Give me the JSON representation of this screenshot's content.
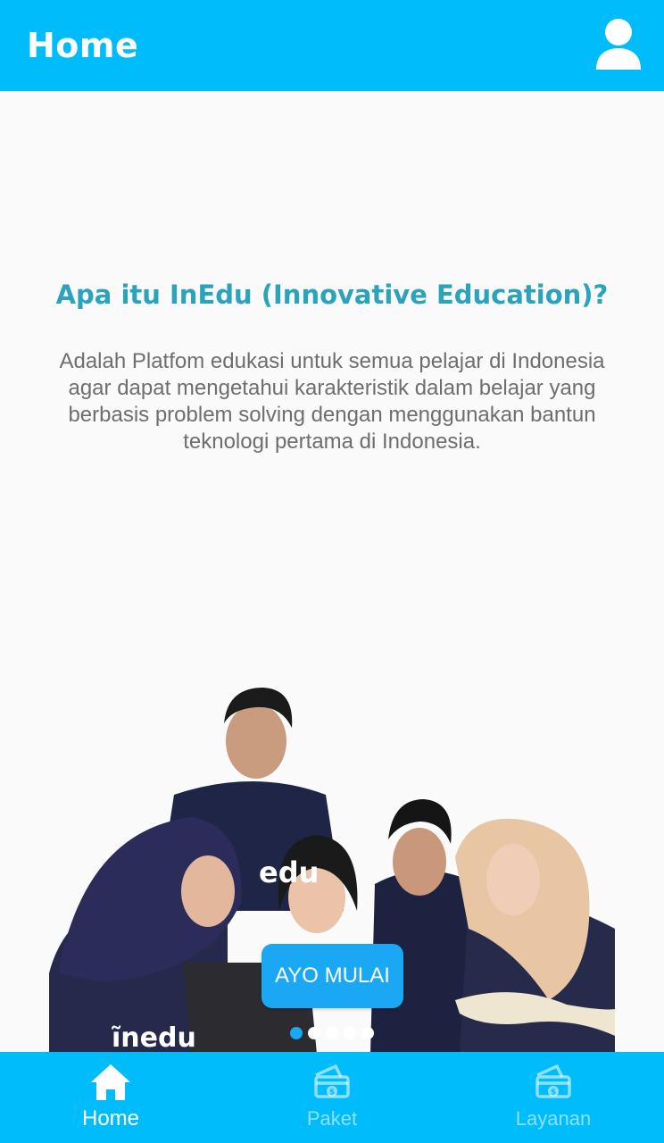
{
  "app_bar": {
    "title": "Home",
    "profile_icon": "person-icon",
    "background": "#00bcfa"
  },
  "intro": {
    "title": "Apa itu InEdu (Innovative Education)?",
    "body": "Adalah Platfom edukasi untuk semua pelajar di Indonesia agar dapat mengetahui karakteristik dalam belajar yang berbasis problem solving dengan menggunakan bantun teknologi pertama di Indonesia.",
    "title_color": "#2aa3bb"
  },
  "carousel": {
    "cta_label": "AYO MULAI",
    "page_count": 5,
    "active_index": 0,
    "accent": "#1aa7f3"
  },
  "bottom_nav": {
    "items": [
      {
        "label": "Home",
        "icon": "home-icon",
        "active": true
      },
      {
        "label": "Paket",
        "icon": "payment-card-icon",
        "active": false
      },
      {
        "label": "Layanan",
        "icon": "payment-card-icon",
        "active": false
      }
    ]
  }
}
